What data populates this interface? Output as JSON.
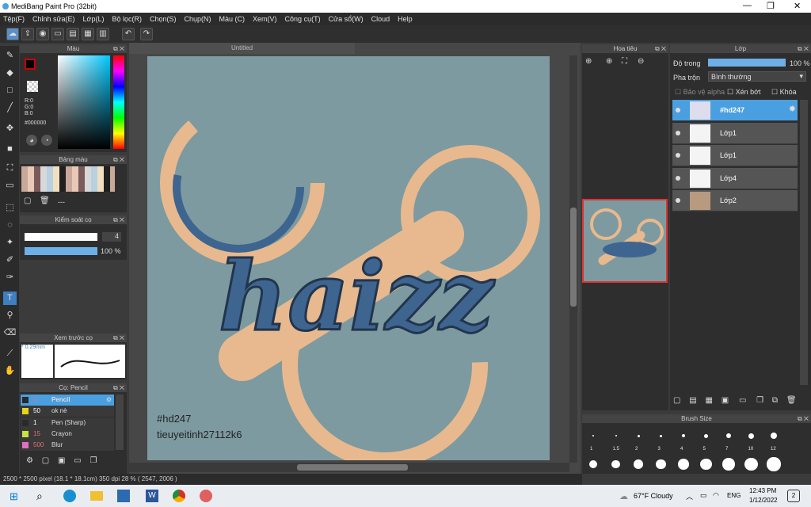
{
  "window": {
    "title": "MediBang Paint Pro (32bit)"
  },
  "menu": [
    "Tệp(F)",
    "Chỉnh sửa(E)",
    "Lớp(L)",
    "Bộ lọc(R)",
    "Chọn(S)",
    "Chụp(N)",
    "Màu (C)",
    "Xem(V)",
    "Công cụ(T)",
    "Cửa sổ(W)",
    "Cloud",
    "Help"
  ],
  "color_panel": {
    "title": "Màu",
    "r": "R:0",
    "g": "G:0",
    "b": "B:0",
    "hex": "#000000"
  },
  "palette_panel": {
    "title": "Bảng màu",
    "dash": "---"
  },
  "brush_control": {
    "title": "Kiểm soát cọ",
    "size": "4",
    "opacity": "100 %",
    "opacity_value": 1.0
  },
  "brush_preview": {
    "title": "Xem trước cọ",
    "size_label": "* 0.29mm"
  },
  "brush_list": {
    "title": "Cọ: Pencil",
    "items": [
      {
        "size": "4",
        "name": "Pencil",
        "color": "#2a2a2a",
        "selected": true
      },
      {
        "size": "50",
        "name": "ok nè",
        "color": "#e5d620",
        "selected": false
      },
      {
        "size": "1",
        "name": "Pen (Sharp)",
        "color": "#2a2a2a",
        "selected": false
      },
      {
        "size": "15",
        "name": "Crayon",
        "color": "#c8e040",
        "selected": false
      },
      {
        "size": "500",
        "name": "Blur",
        "color": "#e070c0",
        "selected": false
      }
    ]
  },
  "canvas": {
    "tab": "Untitled",
    "artwork_text": "haizz",
    "caption_line1": "#hd247",
    "caption_line2": "tieuyeitinh27112k6"
  },
  "navigator": {
    "title": "Hoa tiêu"
  },
  "layers_panel": {
    "title": "Lớp",
    "opacity_label": "Độ trong",
    "opacity_value": "100 %",
    "opacity_fill": 1.0,
    "blend_label": "Pha trộn",
    "blend_value": "Bình thường",
    "protect_alpha": "Bảo vệ alpha",
    "clipping": "Xén bớt",
    "lock": "Khóa",
    "layers": [
      {
        "name": "#hd247",
        "selected": true
      },
      {
        "name": "Lớp1",
        "selected": false
      },
      {
        "name": "Lớp1",
        "selected": false
      },
      {
        "name": "Lớp4",
        "selected": false
      },
      {
        "name": "Lớp2",
        "selected": false
      }
    ]
  },
  "brush_size_panel": {
    "title": "Brush Size",
    "labels": [
      "1",
      "1.5",
      "2",
      "3",
      "4",
      "5",
      "7",
      "10",
      "12"
    ]
  },
  "statusbar": {
    "text": "2500 * 2500 pixel   (18.1 * 18.1cm)   350 dpi   28 %   ( 2547, 2006 )"
  },
  "taskbar": {
    "weather": "67°F  Cloudy",
    "lang": "ENG",
    "time": "12:43 PM",
    "date": "1/12/2022",
    "notif": "2"
  },
  "colors": {
    "accent": "#4a9fe0",
    "canvas_bg": "#7d9aa0",
    "peach": "#e8b98e",
    "lettering": "#3e6590"
  }
}
